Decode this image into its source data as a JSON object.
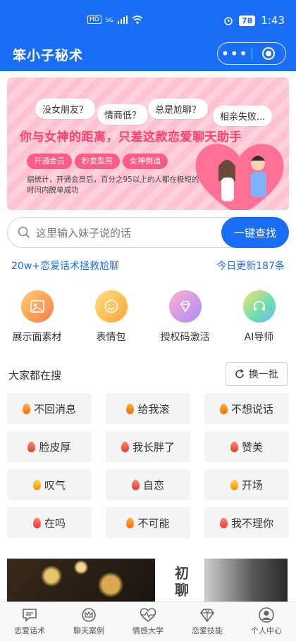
{
  "status_bar": {
    "network_label": "HD",
    "signal_label": "5G",
    "battery": "78",
    "time": "1:43"
  },
  "app": {
    "title": "笨小子秘术",
    "more_icon": "more-dots-icon",
    "close_icon": "target-circle-icon",
    "accent_color": "#1a6ef5"
  },
  "banner": {
    "bubbles": [
      "没女朋友？",
      "情商低？",
      "总是尬聊？",
      "相亲失败..."
    ],
    "headline": "你与女神的距离，只差这款恋爱聊天助手",
    "pills": [
      "开通会员",
      "秒变型男",
      "女神倒追"
    ],
    "note": "据统计，开通会员后，百分之95以上的人都在极短的时间内脱单成功"
  },
  "search": {
    "placeholder": "这里输入妹子说的话",
    "button_label": "一键查找"
  },
  "info": {
    "left": "20w+恋爱话术拯救尬聊",
    "right": "今日更新187条"
  },
  "categories": [
    {
      "label": "展示面素材",
      "icon": "image-icon"
    },
    {
      "label": "表情包",
      "icon": "smiley-icon"
    },
    {
      "label": "授权码激活",
      "icon": "diamond-icon"
    },
    {
      "label": "AI导师",
      "icon": "headset-icon"
    }
  ],
  "trending": {
    "title": "大家都在搜",
    "refresh_label": "换一批",
    "tags": [
      "不回消息",
      "给我滚",
      "不想说话",
      "脸皮厚",
      "我长胖了",
      "赞美",
      "叹气",
      "自恋",
      "开场",
      "在吗",
      "不可能",
      "我不理你"
    ]
  },
  "preview": {
    "vertical_text": "初聊"
  },
  "tabbar": {
    "items": [
      {
        "label": "恋爱话术",
        "icon": "chat-icon"
      },
      {
        "label": "聊天案例",
        "icon": "crown-icon"
      },
      {
        "label": "情感大学",
        "icon": "heartbeat-icon"
      },
      {
        "label": "恋爱技能",
        "icon": "diamond-icon"
      },
      {
        "label": "个人中心",
        "icon": "user-icon"
      }
    ]
  }
}
